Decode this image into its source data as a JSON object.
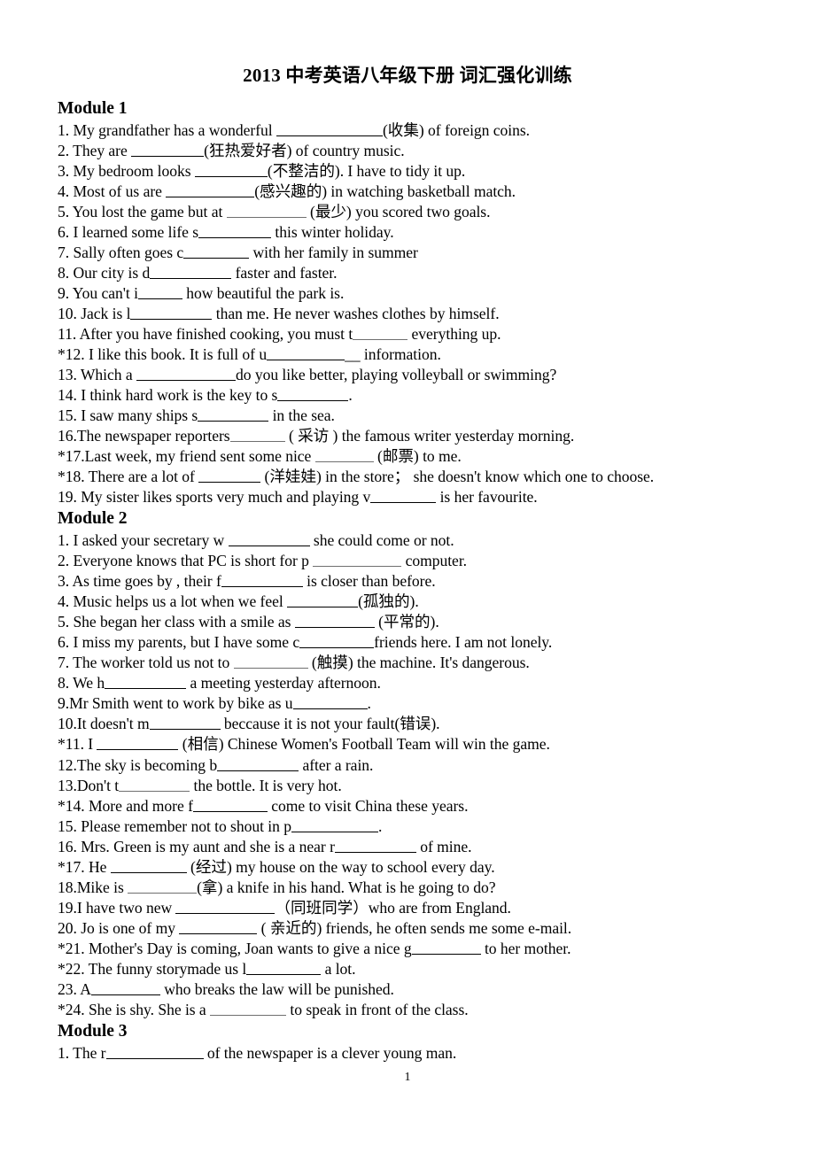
{
  "document": {
    "title": "2013  中考英语八年级下册  词汇强化训练",
    "page_number": "1"
  },
  "modules": [
    {
      "heading": "Module 1",
      "items": [
        {
          "pre": "1. My grandfather has a wonderful ",
          "blank_w": 120,
          "post": "(收集) of foreign coins."
        },
        {
          "pre": "2. They are ",
          "blank_w": 82,
          "post": "(狂热爱好者) of country music."
        },
        {
          "pre": "3. My bedroom looks ",
          "blank_w": 82,
          "post": "(不整洁的). I have to tidy it up."
        },
        {
          "pre": "4. Most of us are ",
          "blank_w": 100,
          "post": "(感兴趣的) in watching basketball match."
        },
        {
          "pre": "5. You lost the game but at ",
          "blank_w": 90,
          "post": " (最少) you scored two goals.",
          "faint": true
        },
        {
          "pre": "6. I learned some life s",
          "blank_w": 82,
          "post": " this winter holiday."
        },
        {
          "pre": "7. Sally often goes c",
          "blank_w": 74,
          "post": " with her family in summer"
        },
        {
          "pre": "8. Our city is d",
          "blank_w": 92,
          "post": " faster and faster."
        },
        {
          "pre": "9. You can't i",
          "blank_w": 50,
          "post": " how beautiful the park is."
        },
        {
          "pre": "10. Jack is l",
          "blank_w": 92,
          "post": " than me. He never washes clothes by himself."
        },
        {
          "pre": "11. After you have finished cooking, you must t",
          "blank_w": 62,
          "post": " everything up.",
          "faint": true
        },
        {
          "pre": "*12. I like this book. It is full of u",
          "blank_w": 88,
          "post": "__  information."
        },
        {
          "pre": "13. Which a ",
          "blank_w": 112,
          "post": "do you like better, playing volleyball or swimming?"
        },
        {
          "pre": "14. I think hard work is the key to s",
          "blank_w": 80,
          "post": "."
        },
        {
          "pre": "15. I saw many ships s",
          "blank_w": 80,
          "post": " in the sea."
        },
        {
          "pre": "16.The newspaper reporters",
          "blank_w": 62,
          "post": " (  采访  ) the famous writer yesterday morning.",
          "faint": true
        },
        {
          "pre": "*17.Last week, my friend sent some nice ",
          "blank_w": 66,
          "post": " (邮票) to me.",
          "faint": true
        },
        {
          "pre": "*18. There are a lot of ",
          "blank_w": 70,
          "post": " (洋娃娃) in the store；  she doesn't know which one to choose."
        },
        {
          "pre": "19. My sister likes sports very much and playing v",
          "blank_w": 74,
          "post": " is her favourite."
        }
      ]
    },
    {
      "heading": "Module 2",
      "items": [
        {
          "pre": "1. I asked your secretary w ",
          "blank_w": 92,
          "post": " she could come or not."
        },
        {
          "pre": "2. Everyone knows that PC is short for p ",
          "blank_w": 100,
          "post": " computer.",
          "faint": true
        },
        {
          "pre": "3. As time goes by , their f",
          "blank_w": 92,
          "post": " is closer than before."
        },
        {
          "pre": "4. Music helps us a lot when we feel ",
          "blank_w": 80,
          "post": "(孤独的)."
        },
        {
          "pre": "5. She began her class with a smile as ",
          "blank_w": 90,
          "post": " (平常的)."
        },
        {
          "pre": "6. I miss my parents, but I have some c",
          "blank_w": 84,
          "post": "friends here. I am not lonely."
        },
        {
          "pre": "7. The worker told us not to ",
          "blank_w": 84,
          "post": " (触摸) the machine. It's dangerous.",
          "faint": true
        },
        {
          "pre": "8. We h",
          "blank_w": 92,
          "post": " a meeting yesterday afternoon."
        },
        {
          "pre": "9.Mr Smith went to work by bike as u",
          "blank_w": 84,
          "post": "."
        },
        {
          "pre": "10.It doesn't m",
          "blank_w": 80,
          "post": " beccause it is not your fault(错误)."
        },
        {
          "pre": "*11. I ",
          "blank_w": 92,
          "post": " (相信) Chinese Women's Football Team will win the game."
        },
        {
          "pre": "12.The sky is becoming b",
          "blank_w": 92,
          "post": " after a rain."
        },
        {
          "pre": "13.Don't t",
          "blank_w": 80,
          "post": " the bottle. It is very hot.",
          "faint": true
        },
        {
          "pre": "*14. More and more f",
          "blank_w": 84,
          "post": " come to visit China these years."
        },
        {
          "pre": "15. Please remember not to shout in p",
          "blank_w": 98,
          "post": "."
        },
        {
          "pre": "16. Mrs. Green is my aunt and she is a near r",
          "blank_w": 92,
          "post": " of mine."
        },
        {
          "pre": "*17. He ",
          "blank_w": 86,
          "post": " (经过) my house on the way to school every day."
        },
        {
          "pre": "18.Mike is ",
          "blank_w": 78,
          "post": "(拿) a knife in his hand. What is he going to do?",
          "faint": true
        },
        {
          "pre": "19.I have two new ",
          "blank_w": 112,
          "post": "（同班同学）who are from England."
        },
        {
          "pre": "20. Jo is one of my ",
          "blank_w": 88,
          "post": " (  亲近的) friends, he often sends me some e-mail."
        },
        {
          "pre": "*21. Mother's Day is coming, Joan wants to give a nice g",
          "blank_w": 78,
          "post": " to her mother."
        },
        {
          "pre": "*22. The funny storymade us l",
          "blank_w": 84,
          "post": " a lot."
        },
        {
          "pre": "23. A",
          "blank_w": 78,
          "post": " who breaks the law will be punished."
        },
        {
          "pre": "*24. She is shy. She is a ",
          "blank_w": 86,
          "post": " to speak in front of the class.",
          "faint": true
        }
      ]
    },
    {
      "heading": "Module 3",
      "items": [
        {
          "pre": "1. The r",
          "blank_w": 110,
          "post": " of the newspaper is a clever young man."
        }
      ]
    }
  ]
}
